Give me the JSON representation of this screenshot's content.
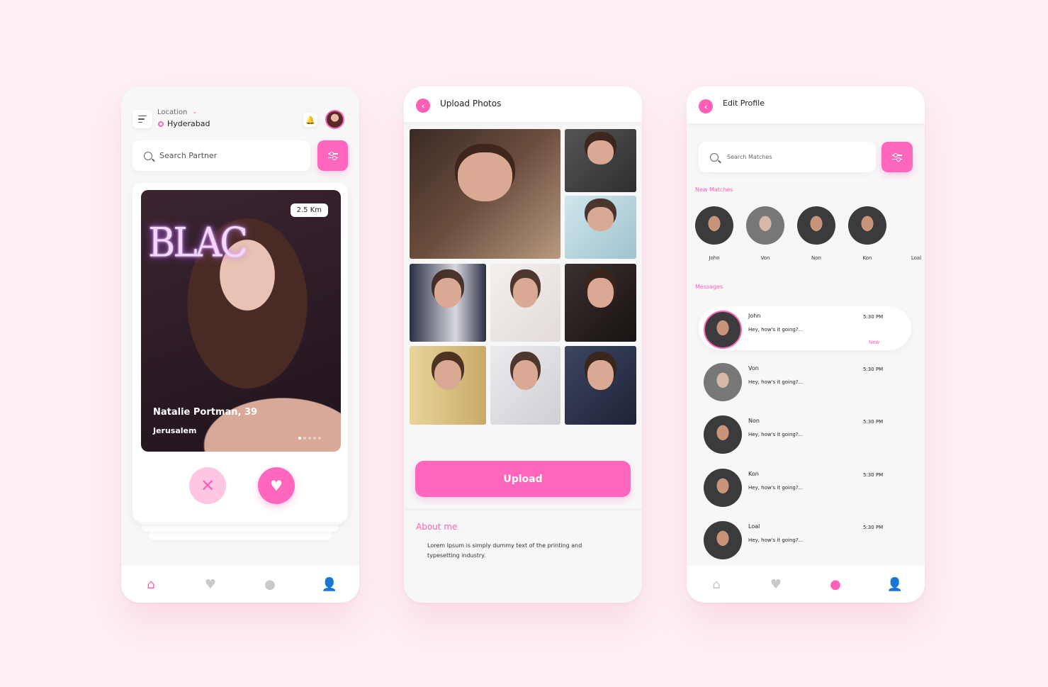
{
  "colors": {
    "accent": "#ff66bd",
    "accent_light": "#ffc6e3",
    "background": "#fdf0f5"
  },
  "home": {
    "location_label": "Location",
    "city": "Hyderabad",
    "search_placeholder": "Search Partner",
    "card": {
      "distance": "2.5 Km",
      "poster_text": "BLAC",
      "name": "Natalie Portman, 39",
      "city": "Jerusalem",
      "photo_index": 1,
      "photo_count": 5
    },
    "tabs": [
      "home-icon",
      "heart-icon",
      "chat-icon",
      "user-icon"
    ],
    "active_tab": 0
  },
  "upload": {
    "title": "Upload Photos",
    "button": "Upload",
    "about_title": "About me",
    "about_text": "Lorem Ipsum is simply dummy text of the printing and typesetting industry."
  },
  "profile": {
    "title": "Edit Profile",
    "search_placeholder": "Search Matches",
    "new_matches_title": "New Matches",
    "matches": [
      "John",
      "Von",
      "Non",
      "Kon",
      "Loal"
    ],
    "messages_title": "Messages",
    "messages": [
      {
        "name": "John",
        "preview": "Hey, how's it going?...",
        "time": "5:30 PM",
        "badge": "New"
      },
      {
        "name": "Von",
        "preview": "Hey, how's it going?...",
        "time": "5:30 PM",
        "badge": ""
      },
      {
        "name": "Non",
        "preview": "Hey, how's it going?...",
        "time": "5:30 PM",
        "badge": ""
      },
      {
        "name": "Kon",
        "preview": "Hey, how's it going?...",
        "time": "5:30 PM",
        "badge": ""
      },
      {
        "name": "Loal",
        "preview": "Hey, how's it going?...",
        "time": "5:30 PM",
        "badge": ""
      }
    ],
    "active_tab": 2
  }
}
